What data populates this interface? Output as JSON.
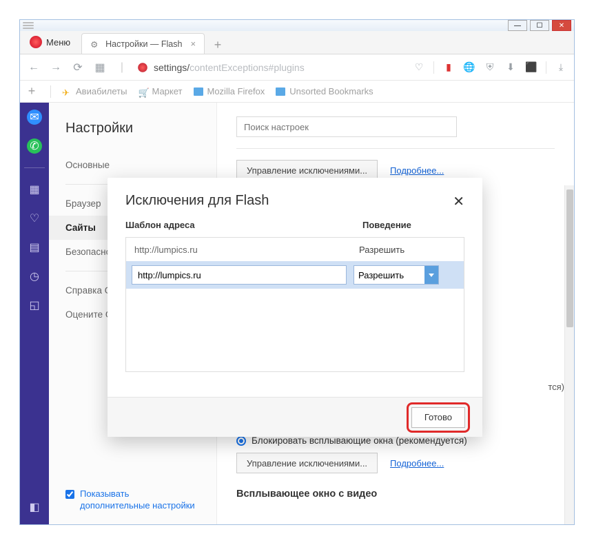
{
  "titlebar": {
    "minimize": "—",
    "maximize": "☐",
    "close": "✕"
  },
  "menu_label": "Меню",
  "tab": {
    "title": "Настройки — Flash"
  },
  "address": {
    "prefix": "settings/",
    "path": "contentExceptions#plugins"
  },
  "bookmarks": {
    "aviabilety": "Авиабилеты",
    "market": "Маркет",
    "mozilla": "Mozilla Firefox",
    "unsorted": "Unsorted Bookmarks"
  },
  "settings": {
    "title": "Настройки",
    "items": {
      "basic": "Основные",
      "browser": "Браузер",
      "sites": "Сайты",
      "security": "Безопасность"
    },
    "help": "Справка Opera",
    "feedback": "Оцените Opera",
    "show_additional": "Показывать дополнительные настройки"
  },
  "main": {
    "search_placeholder": "Поиск настроек",
    "manage_button": "Управление исключениями...",
    "learn_more": "Подробнее...",
    "block_popups": "Блокировать всплывающие окна (рекомендуется)",
    "pip_heading": "Всплывающее окно с видео",
    "ghost": "тся)"
  },
  "modal": {
    "title": "Исключения для Flash",
    "col_pattern": "Шаблон адреса",
    "col_behavior": "Поведение",
    "row_url": "http://lumpics.ru",
    "row_behavior": "Разрешить",
    "input_value": "http://lumpics.ru",
    "select_value": "Разрешить",
    "done": "Готово"
  }
}
